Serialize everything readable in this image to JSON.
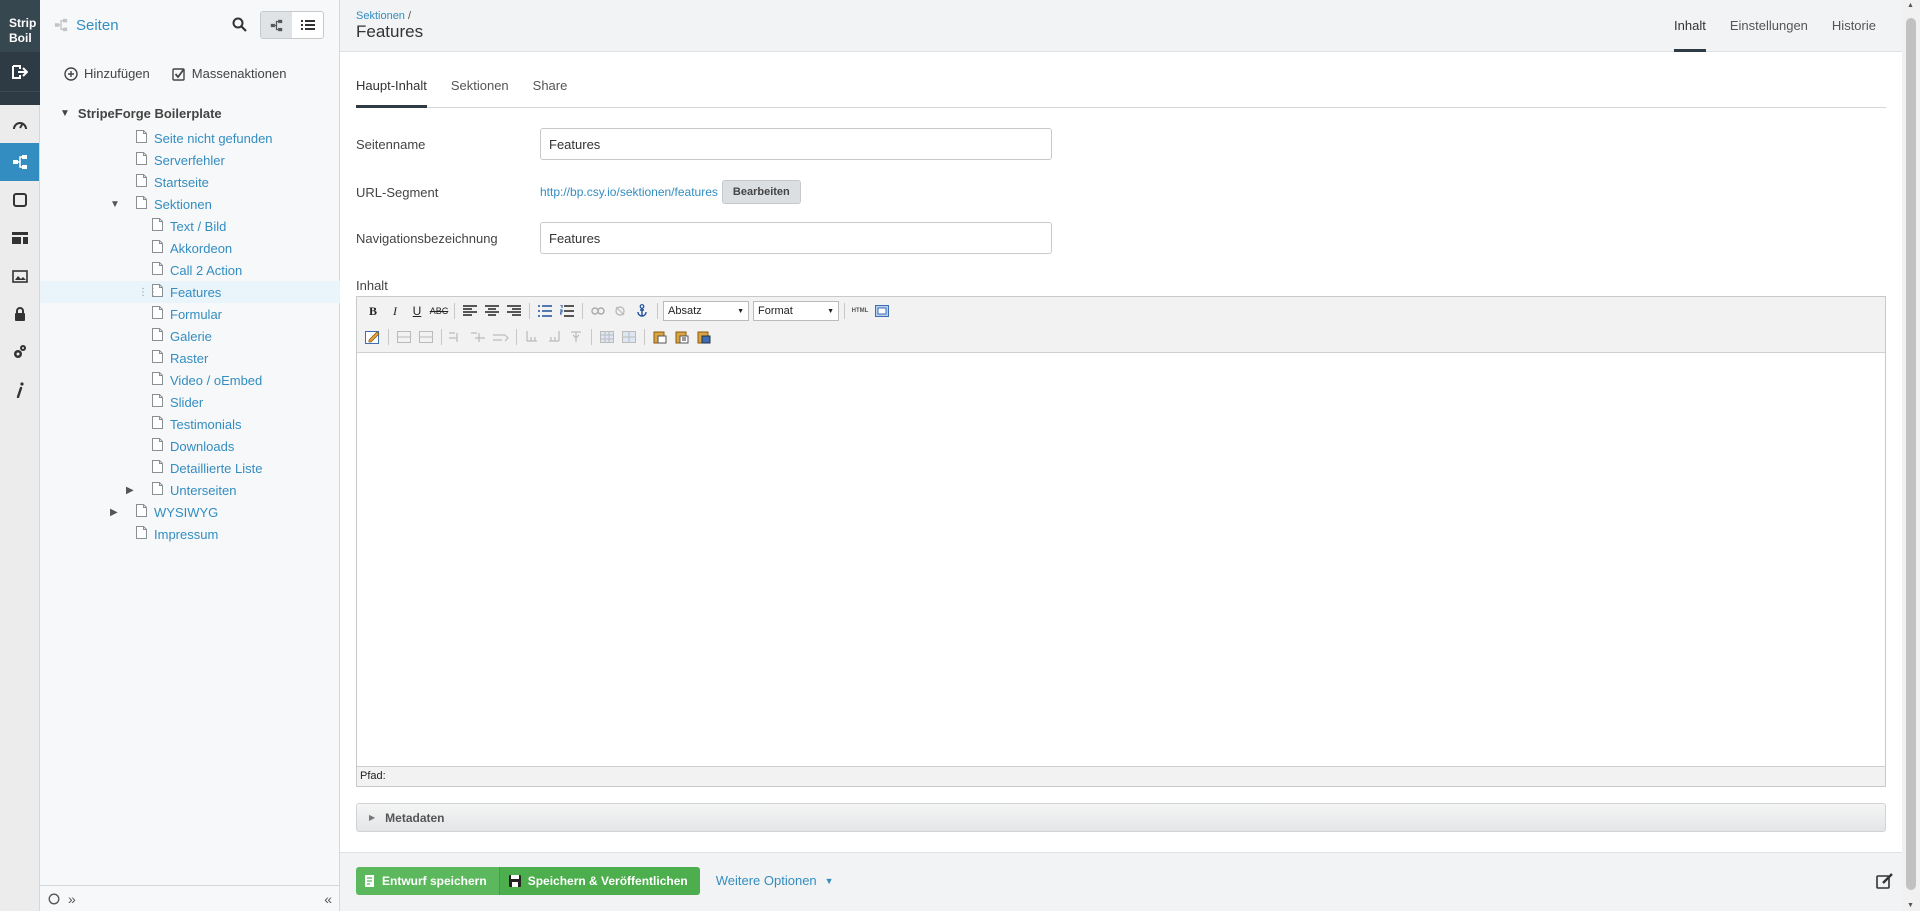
{
  "rail": {
    "logo_line1": "Strip",
    "logo_line2": "Boil",
    "items": [
      "logout-icon",
      "dashboard-icon",
      "sitetree-icon",
      "square-icon",
      "layout-icon",
      "image-icon",
      "lock-icon",
      "gears-icon",
      "info-icon"
    ],
    "active": "sitetree-icon"
  },
  "tree": {
    "title": "Seiten",
    "add_label": "Hinzufügen",
    "bulk_label": "Massenaktionen",
    "root": "StripeForge Boilerplate",
    "items": [
      {
        "label": "Seite nicht gefunden",
        "level": 0
      },
      {
        "label": "Serverfehler",
        "level": 0
      },
      {
        "label": "Startseite",
        "level": 0
      },
      {
        "label": "Sektionen",
        "level": 0,
        "expanded": true
      },
      {
        "label": "Text / Bild",
        "level": 1
      },
      {
        "label": "Akkordeon",
        "level": 1
      },
      {
        "label": "Call 2 Action",
        "level": 1
      },
      {
        "label": "Features",
        "level": 1,
        "selected": true
      },
      {
        "label": "Formular",
        "level": 1
      },
      {
        "label": "Galerie",
        "level": 1
      },
      {
        "label": "Raster",
        "level": 1
      },
      {
        "label": "Video / oEmbed",
        "level": 1
      },
      {
        "label": "Slider",
        "level": 1
      },
      {
        "label": "Testimonials",
        "level": 1
      },
      {
        "label": "Downloads",
        "level": 1
      },
      {
        "label": "Detaillierte Liste",
        "level": 1
      },
      {
        "label": "Unterseiten",
        "level": 1,
        "collapsed": true
      },
      {
        "label": "WYSIWYG",
        "level": 0,
        "collapsed": true
      },
      {
        "label": "Impressum",
        "level": 0
      }
    ],
    "footer_expand": "»",
    "footer_collapse": "«"
  },
  "header": {
    "breadcrumb": "Sektionen",
    "breadcrumb_sep": "/",
    "title": "Features",
    "tabs": [
      "Inhalt",
      "Einstellungen",
      "Historie"
    ],
    "active_tab": "Inhalt"
  },
  "subtabs": {
    "items": [
      "Haupt-Inhalt",
      "Sektionen",
      "Share"
    ],
    "active": "Haupt-Inhalt"
  },
  "form": {
    "pagename_label": "Seitenname",
    "pagename_value": "Features",
    "url_label": "URL-Segment",
    "url_value": "http://bp.csy.io/sektionen/features",
    "url_edit": "Bearbeiten",
    "nav_label": "Navigationsbezeichnung",
    "nav_value": "Features",
    "content_label": "Inhalt"
  },
  "editor": {
    "block_format": "Absatz",
    "style_format": "Format",
    "html_label": "HTML",
    "status": "Pfad:"
  },
  "metadata": {
    "label": "Metadaten"
  },
  "footer": {
    "save_draft": "Entwurf speichern",
    "save_publish": "Speichern & Veröffentlichen",
    "more_options": "Weitere Optionen"
  },
  "colors": {
    "accent": "#338dc1",
    "rail": "#2f3b44",
    "success": "#5cb85c"
  }
}
